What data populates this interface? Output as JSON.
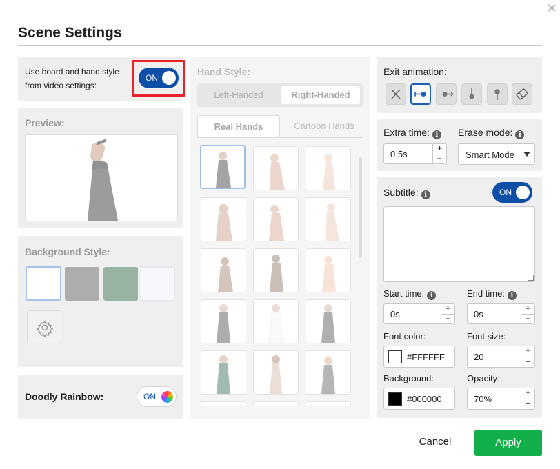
{
  "dialog": {
    "title": "Scene Settings",
    "close_icon": "close-icon"
  },
  "board_hand": {
    "label_line1": "Use board and hand style",
    "label_line2": "from video settings:",
    "toggle": "ON"
  },
  "preview": {
    "label": "Preview:"
  },
  "background_style": {
    "label": "Background Style:",
    "swatches": [
      "#ffffff",
      "#5e5e5e",
      "#2e6b45",
      "#f7f8fb"
    ],
    "settings_icon": "gear-icon"
  },
  "doodly_rainbow": {
    "label": "Doodly Rainbow:",
    "toggle": "ON"
  },
  "hand_style": {
    "label": "Hand Style:",
    "handedness": [
      "Left-Handed",
      "Right-Handed"
    ],
    "selected_handedness": "Right-Handed",
    "hand_tabs": [
      "Real Hands",
      "Cartoon Hands"
    ],
    "selected_tab": "Real Hands"
  },
  "exit_animation": {
    "label": "Exit animation:",
    "options": [
      "none-icon",
      "slide-out-icon",
      "push-out-icon",
      "move-down-icon",
      "drop-pin-icon",
      "eraser-icon"
    ],
    "selected": "slide-out-icon"
  },
  "extra_time": {
    "label": "Extra time:",
    "value": "0.5s"
  },
  "erase_mode": {
    "label": "Erase mode:",
    "value": "Smart Mode"
  },
  "subtitle": {
    "label": "Subtitle:",
    "toggle": "ON",
    "text": "",
    "start_time_label": "Start time:",
    "start_time": "0s",
    "end_time_label": "End time:",
    "end_time": "0s",
    "font_color_label": "Font color:",
    "font_color": "#FFFFFF",
    "font_size_label": "Font size:",
    "font_size": "20",
    "background_label": "Background:",
    "background": "#000000",
    "opacity_label": "Opacity:",
    "opacity": "70%"
  },
  "footer": {
    "cancel": "Cancel",
    "apply": "Apply"
  },
  "colors": {
    "accent": "#0d4ea6",
    "apply": "#12b04a",
    "highlight": "#e8232a"
  }
}
